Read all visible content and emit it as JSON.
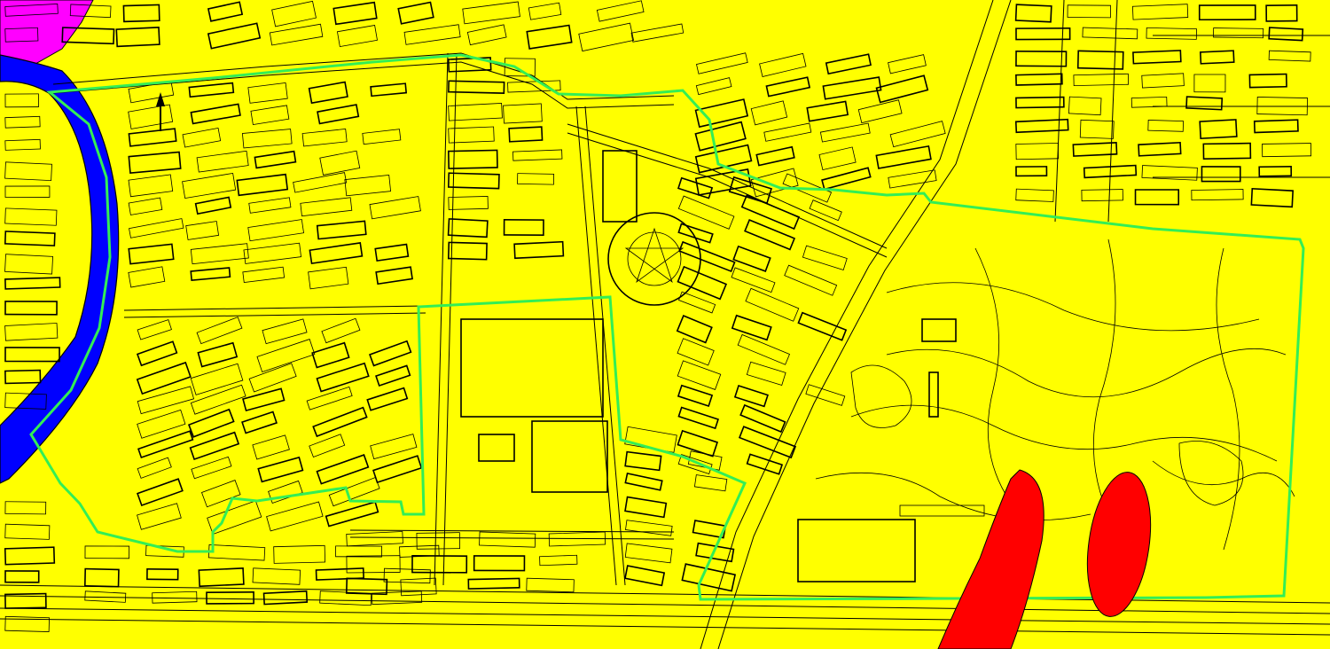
{
  "map": {
    "colors": {
      "base": "#ffff00",
      "water": "#0000ff",
      "magenta_zone": "#ff00ff",
      "boundary": "#33ee55",
      "hazard": "#ff0000",
      "linework": "#000000"
    },
    "layers": [
      {
        "id": "base-map",
        "kind": "cadastral-linework"
      },
      {
        "id": "river",
        "kind": "water"
      },
      {
        "id": "magenta-zone",
        "kind": "area"
      },
      {
        "id": "study-boundary",
        "kind": "outline"
      },
      {
        "id": "hazard-zones",
        "kind": "ellipses",
        "count": 2
      }
    ],
    "north_arrow": true
  }
}
